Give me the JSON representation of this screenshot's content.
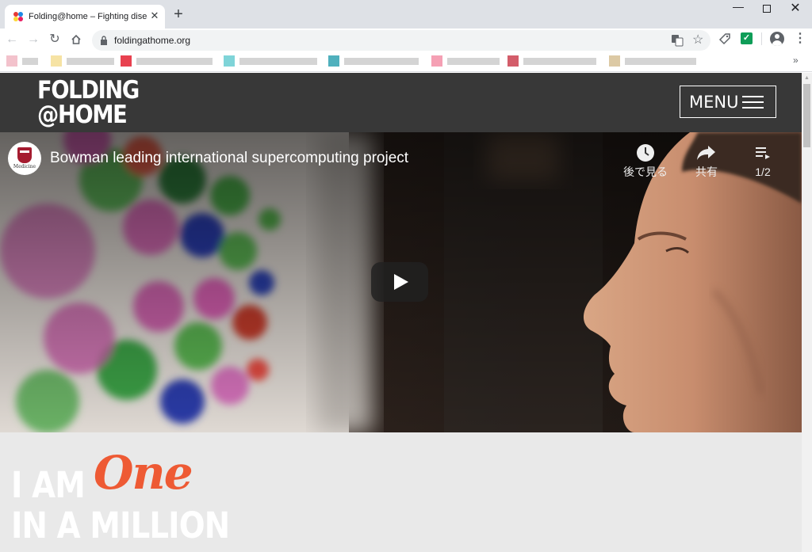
{
  "browser": {
    "tab": {
      "title": "Folding@home – Fighting diseas"
    },
    "address": {
      "url": "foldingathome.org"
    },
    "bookmarks_overflow": "»",
    "ext_check": "✓"
  },
  "site": {
    "logo": {
      "line1": "FOLDING",
      "line2": "@HOME"
    },
    "menu_label": "MENU"
  },
  "video": {
    "channel_badge": "Medicine",
    "title": "Bowman leading international supercomputing project",
    "watch_later_label": "後で見る",
    "share_label": "共有",
    "playlist_label": "1/2"
  },
  "hero": {
    "line1": "I AM",
    "script": "One",
    "line2": "IN A MILLION",
    "accent_color": "#ee5a34"
  },
  "colors": {
    "header_bg": "#383838",
    "page_bg": "#e9e9e9",
    "tabstrip_bg": "#dee1e6"
  }
}
